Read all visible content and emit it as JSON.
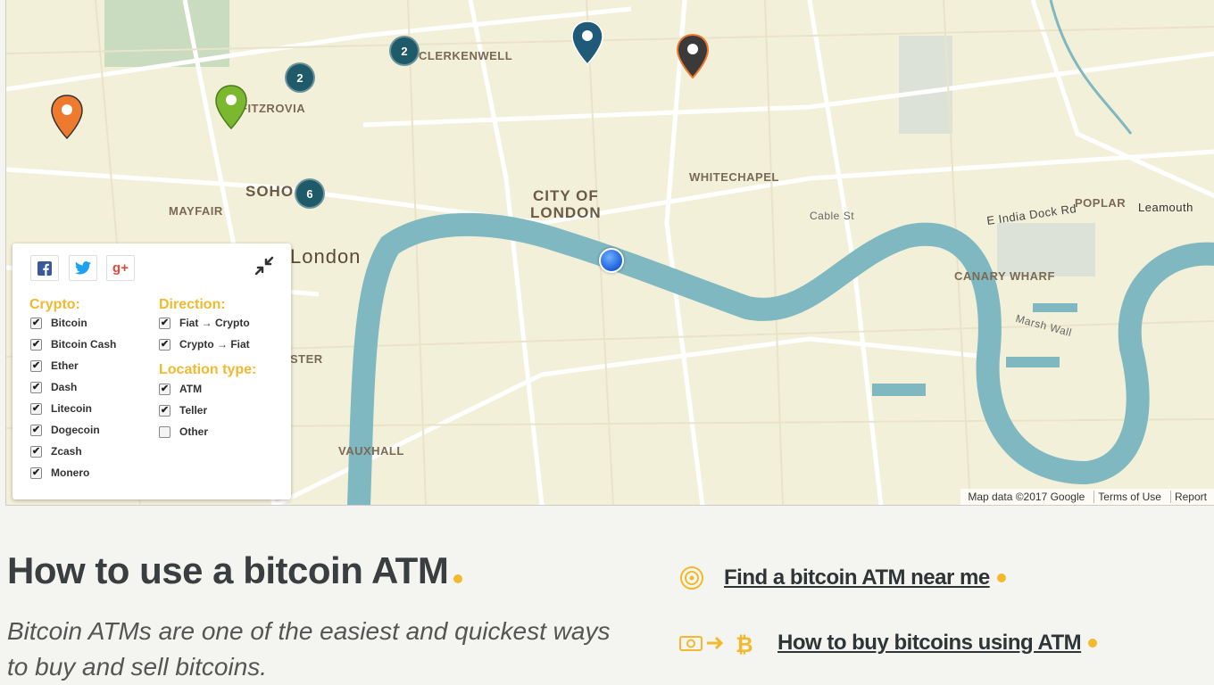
{
  "map": {
    "labels": {
      "clerkenwell": "CLERKENWELL",
      "fitzrovia": "FITZROVIA",
      "soho": "SOHO",
      "mayfair": "MAYFAIR",
      "city_of": "CITY OF",
      "london_city": "LONDON",
      "london": "London",
      "whitechapel": "WHITECHAPEL",
      "poplar": "POPLAR",
      "leamouth": "Leamouth",
      "canary_wharf": "CANARY WHARF",
      "vauxhall": "VAUXHALL",
      "ster": "STER",
      "e_india_dock": "E India Dock Rd",
      "cable_st": "Cable St",
      "marsh_wall": "Marsh Wall"
    },
    "clusters": [
      {
        "count": "2"
      },
      {
        "count": "2"
      },
      {
        "count": "6"
      }
    ],
    "pins": [
      {
        "color": "#1f5a78"
      },
      {
        "color": "#ee7a2e"
      },
      {
        "color": "#ee7a2e"
      },
      {
        "color": "#7cb82f"
      }
    ],
    "attribution": {
      "data": "Map data ©2017 Google",
      "terms": "Terms of Use",
      "report": "Report"
    }
  },
  "filter": {
    "social": [
      "facebook-icon",
      "twitter-icon",
      "google-plus-icon"
    ],
    "crypto_title": "Crypto:",
    "crypto": [
      {
        "label": "Bitcoin",
        "checked": true
      },
      {
        "label": "Bitcoin Cash",
        "checked": true
      },
      {
        "label": "Ether",
        "checked": true
      },
      {
        "label": "Dash",
        "checked": true
      },
      {
        "label": "Litecoin",
        "checked": true
      },
      {
        "label": "Dogecoin",
        "checked": true
      },
      {
        "label": "Zcash",
        "checked": true
      },
      {
        "label": "Monero",
        "checked": true
      }
    ],
    "direction_title": "Direction:",
    "direction": [
      {
        "label": "Fiat → Crypto",
        "checked": true
      },
      {
        "label": "Crypto → Fiat",
        "checked": true
      }
    ],
    "location_title": "Location type:",
    "location": [
      {
        "label": "ATM",
        "checked": true
      },
      {
        "label": "Teller",
        "checked": true
      },
      {
        "label": "Other",
        "checked": false
      }
    ]
  },
  "content": {
    "title": "How to use a bitcoin ATM",
    "intro": "Bitcoin ATMs are one of the easiest and quickest ways to buy and sell bitcoins.",
    "link_find": "Find a bitcoin ATM near me",
    "link_buy": "How to buy bitcoins using ATM"
  },
  "colors": {
    "accent": "#f2b92f",
    "river": "#7fb8c0",
    "heading": "#3a3e40"
  }
}
